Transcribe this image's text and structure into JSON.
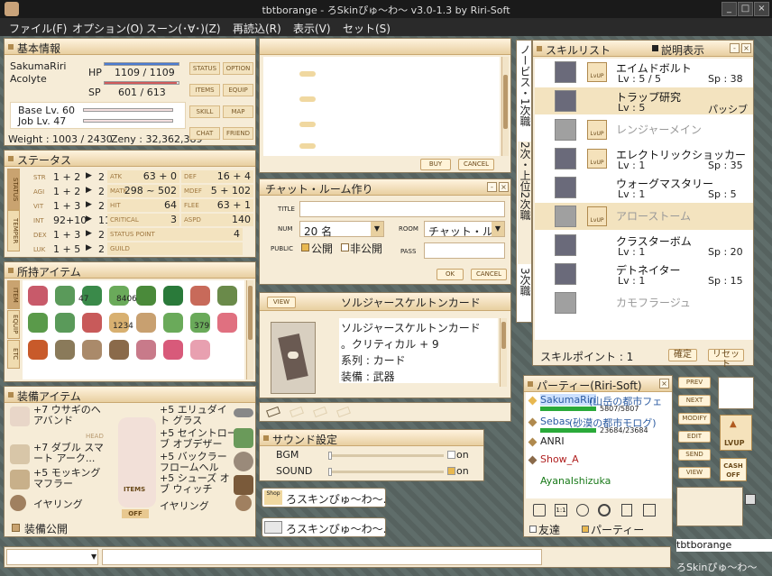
{
  "window": {
    "title": "tbtborange - ろSkinぴゅ～わ～ v3.0-1.3 by Riri-Soft"
  },
  "menu": [
    "ファイル(F)",
    "オプション(O)",
    "スーン(･∀･)(Z)",
    "再読込(R)",
    "表示(V)",
    "セット(S)"
  ],
  "basic": {
    "title": "基本情報",
    "name": "SakumaRiri",
    "job": "Acolyte",
    "hp_label": "HP",
    "hp": "1109 / 1109",
    "hp_frac": 1.0,
    "sp_label": "SP",
    "sp": "601 / 613",
    "sp_frac": 0.98,
    "base_lv": "Base Lv. 60",
    "job_lv": "Job Lv. 47",
    "weight": "Weight : 1003 / 2430",
    "zeny": "Zeny : 32,362,389",
    "buttons": [
      "STATUS",
      "OPTION",
      "ITEMS",
      "EQUIP",
      "SKILL",
      "MAP",
      "CHAT",
      "FRIEND"
    ]
  },
  "status": {
    "title": "ステータス",
    "stats": [
      {
        "name": "STR",
        "val": "1 + 2",
        "pts": "2"
      },
      {
        "name": "AGI",
        "val": "1 + 2",
        "pts": "2"
      },
      {
        "name": "VIT",
        "val": "1 + 3",
        "pts": "2"
      },
      {
        "name": "INT",
        "val": "92+10",
        "pts": "11"
      },
      {
        "name": "DEX",
        "val": "1 + 3",
        "pts": "2"
      },
      {
        "name": "LUK",
        "val": "1 + 5",
        "pts": "2"
      }
    ],
    "left": [
      {
        "name": "ATK",
        "val": "63 + 0"
      },
      {
        "name": "MATK",
        "val": "298 ~ 502"
      },
      {
        "name": "HIT",
        "val": "64"
      },
      {
        "name": "CRITICAL",
        "val": "3"
      },
      {
        "name": "STATUS POINT",
        "val": "4"
      },
      {
        "name": "GUILD",
        "val": ""
      }
    ],
    "right": [
      {
        "name": "DEF",
        "val": "16 + 4"
      },
      {
        "name": "MDEF",
        "val": "5 + 102"
      },
      {
        "name": "FLEE",
        "val": "63 + 1"
      },
      {
        "name": "ASPD",
        "val": "140"
      }
    ],
    "tabs": [
      "STATUS",
      "TEMPER"
    ]
  },
  "items": {
    "title": "所持アイテム",
    "tabs": [
      "ITEM",
      "EQUIP",
      "ETC"
    ],
    "counts": [
      "47",
      "8406",
      "1234",
      "379"
    ]
  },
  "equip": {
    "title": "装備アイテム",
    "left": [
      "+7 ウサギのヘアバンド",
      "+7 ダブル スマート アーク...",
      "+5 モッキング マフラー",
      "イヤリング"
    ],
    "right": [
      "+5 エリュダイト グラス",
      "+5 セイントローブ オブデザー",
      "+5 バックラー フロームヘル",
      "+5 シューズ オブ ウィッチ",
      "イヤリング"
    ],
    "public": "装備公開",
    "items_label": "ITEMS",
    "off_label": "OFF",
    "head_label": "HEAD"
  },
  "shop": {
    "buy": "BUY",
    "cancel": "CANCEL"
  },
  "chatroom": {
    "title": "チャット・ルーム作り",
    "title_label": "TITLE",
    "num_label": "NUM",
    "num": "20 名",
    "room_label": "ROOM",
    "room": "チャット・ルー",
    "public_label": "PUBLIC",
    "open": "公開",
    "closed": "非公開",
    "pass_label": "PASS",
    "ok": "OK",
    "cancel": "CANCEL"
  },
  "card": {
    "title": "ソルジャースケルトンカード",
    "view": "VIEW",
    "desc": [
      "ソルジャースケルトンカード",
      "。クリティカル + 9",
      "系列 : カード",
      "装備 : 武器"
    ]
  },
  "sound": {
    "title": "サウンド設定",
    "bgm": "BGM",
    "sound": "SOUND",
    "on": "on"
  },
  "chat": {
    "line1": "ろスキンぴゅ～わ～.",
    "line2": "ろスキンぴゅ～わ～."
  },
  "skilltabs": [
    "ノービス・1次職",
    "2次・上位2次職",
    "3次職"
  ],
  "skills": {
    "title": "スキルリスト",
    "desc_toggle": "説明表示",
    "list": [
      {
        "name": "エイムドボルト",
        "lv": "Lv : 5 / 5",
        "sp": "Sp : 38",
        "up": true,
        "dim": false
      },
      {
        "name": "トラップ研究",
        "lv": "Lv : 5",
        "sp": "パッシブ",
        "up": false,
        "dim": false
      },
      {
        "name": "レンジャーメイン",
        "lv": "",
        "sp": "",
        "up": true,
        "dim": true
      },
      {
        "name": "エレクトリックショッカー",
        "lv": "Lv : 1",
        "sp": "Sp : 35",
        "up": true,
        "dim": false
      },
      {
        "name": "ウォーグマスタリー",
        "lv": "Lv : 1",
        "sp": "Sp : 5",
        "up": false,
        "dim": false
      },
      {
        "name": "アローストーム",
        "lv": "",
        "sp": "",
        "up": true,
        "dim": true
      },
      {
        "name": "クラスターボム",
        "lv": "Lv : 1",
        "sp": "Sp : 20",
        "up": false,
        "dim": false
      },
      {
        "name": "デトネイター",
        "lv": "Lv : 1",
        "sp": "Sp : 15",
        "up": false,
        "dim": false
      },
      {
        "name": "カモフラージュ",
        "lv": "",
        "sp": "",
        "up": false,
        "dim": true
      }
    ],
    "points": "スキルポイント : 1",
    "ok": "確定",
    "reset": "リセット"
  },
  "party": {
    "title": "パーティー(Riri-Soft)",
    "members": [
      {
        "name": "SakumaRiri",
        "map": "(山岳の都市フェ",
        "hp": "5807/5807",
        "color": "#2a5aa0"
      },
      {
        "name": "Sebas",
        "map": "(砂漠の都市モログ)",
        "hp": "23684/23684",
        "color": "#2a5aa0"
      },
      {
        "name": "ANRI",
        "map": "",
        "hp": "",
        "color": "#222222"
      },
      {
        "name": "Show_A",
        "map": "",
        "hp": "",
        "color": "#b02020"
      },
      {
        "name": "AyanaIshizuka",
        "map": "",
        "hp": "",
        "color": "#1a7a1a"
      }
    ],
    "friend": "友達",
    "party": "パーティー"
  },
  "sidebtns": [
    "PREV",
    "NEXT",
    "MODIFY",
    "EDIT",
    "SEND",
    "VIEW"
  ],
  "lvup": "LVUP",
  "cashoff": "CASH OFF",
  "bottom": {
    "name": "tbtborange",
    "skin": "ろSkinぴゅ～わ～"
  }
}
